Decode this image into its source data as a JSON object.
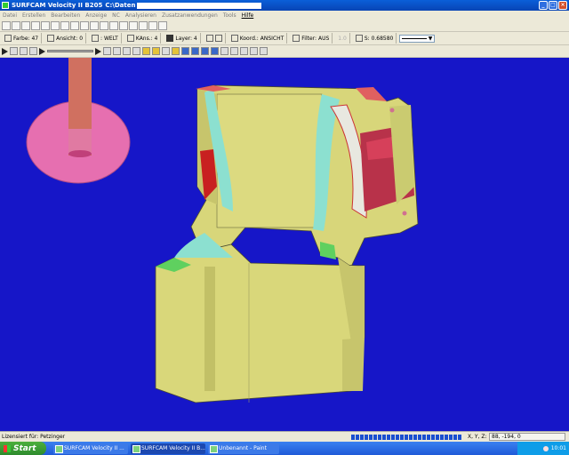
{
  "window": {
    "title": "SURFCAM Velocity II B205",
    "path_label": "C:\\Daten"
  },
  "menu": [
    "Datei",
    "Erstellen",
    "Bearbeiten",
    "Anzeige",
    "NC",
    "Analysieren",
    "Zusatzanwendungen",
    "Tools",
    "Hilfe"
  ],
  "menu_active": "Hilfe",
  "toolbar2": {
    "farbe": "Farbe: 47",
    "ansicht": "Ansicht: 0",
    "welt": ": WELT",
    "kans": "KAns.: 4",
    "layer": "Layer: 4",
    "koord": "Koord.: ANSICHT",
    "filter": "Filter: AUS",
    "tol": "1.0",
    "s_value": "S: 0.68580"
  },
  "status": {
    "licensed": "Lizensiert für: Petzinger",
    "coord_label": "X, Y, Z:",
    "coord_value": "88, -194, 0"
  },
  "taskbar": {
    "start": "Start",
    "tasks": [
      "SURFCAM Velocity II ...",
      "SURFCAM Velocity II B...",
      "Unbenannt - Paint"
    ],
    "clock": "10:01"
  },
  "colors": {
    "viewport_bg": "#1616c8",
    "part_face": "#d9d77a",
    "tool_disc": "#e66fb0"
  }
}
